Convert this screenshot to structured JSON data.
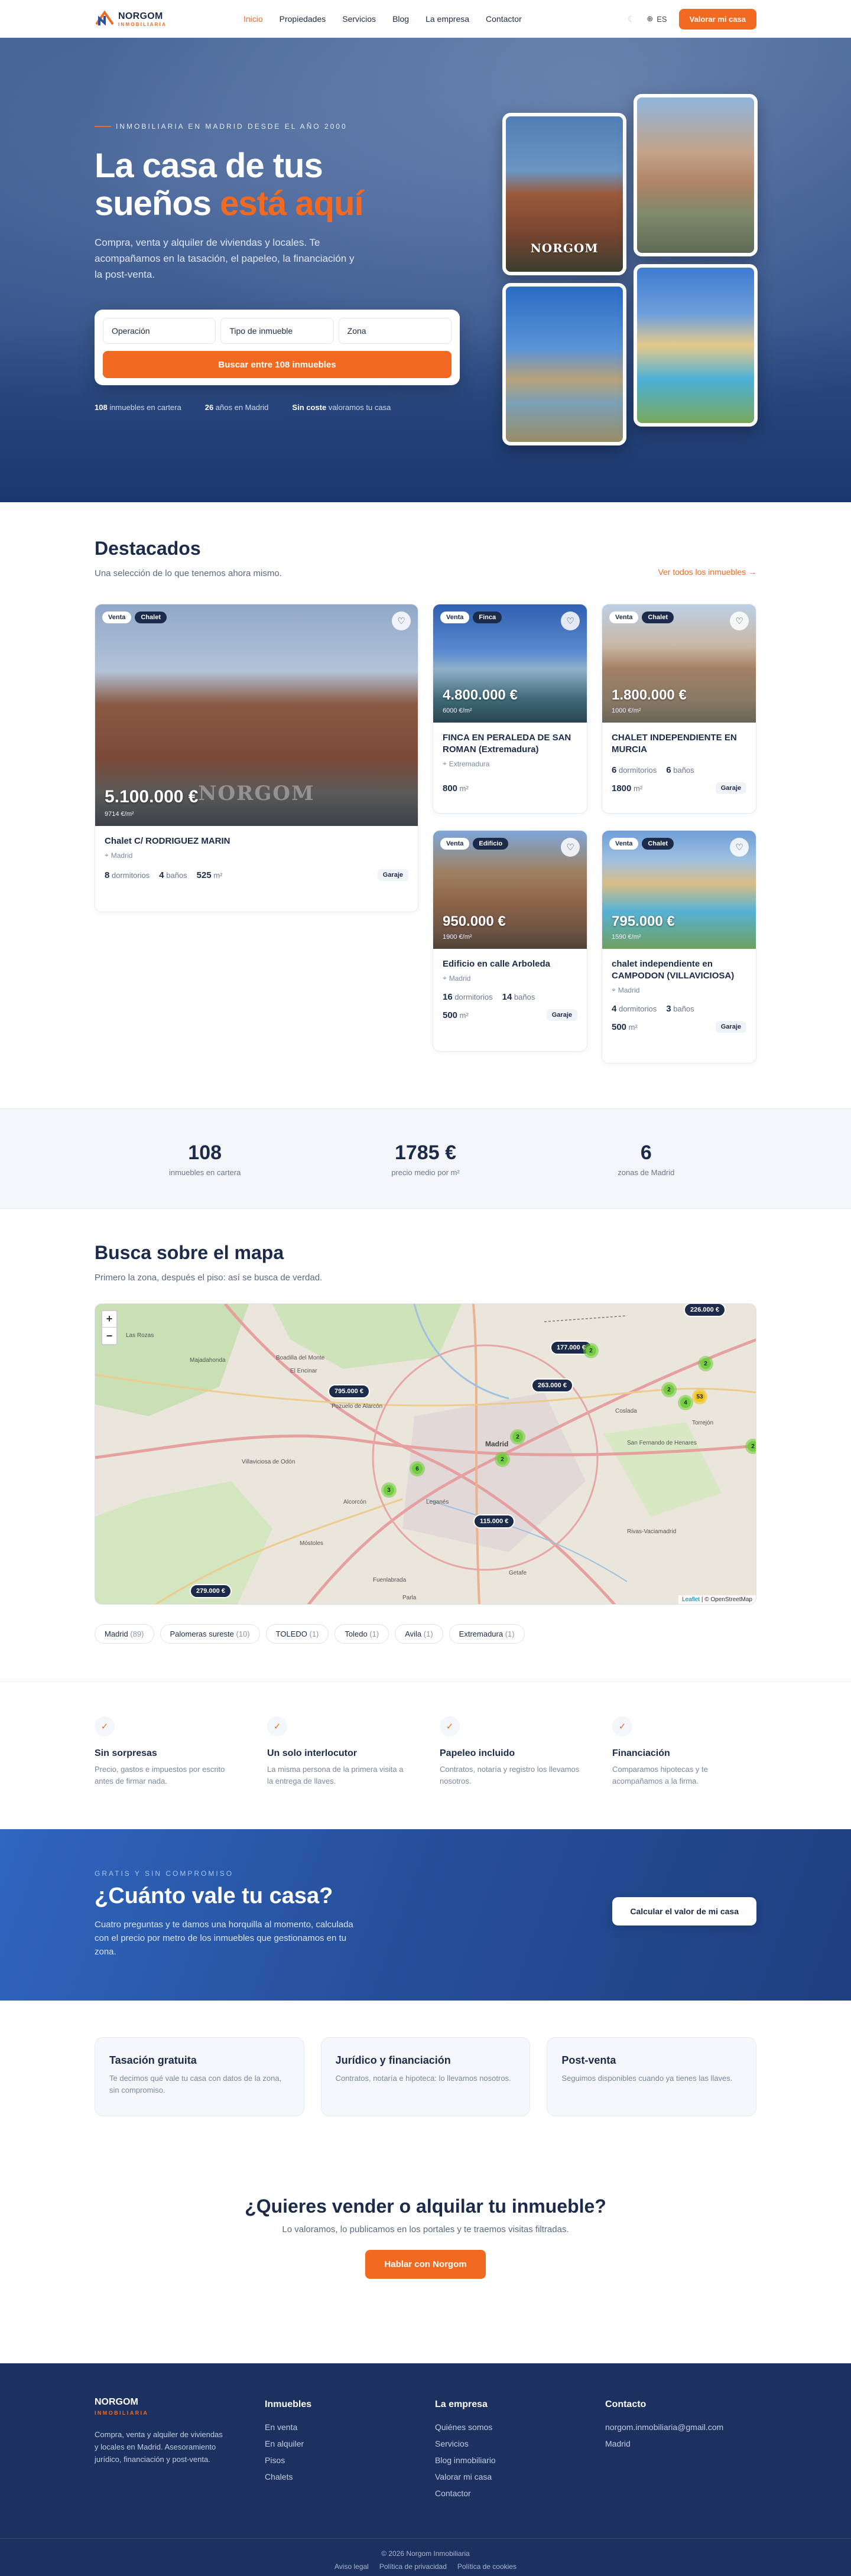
{
  "brand": {
    "name": "NORGOM",
    "sub": "INMOBILIARIA",
    "accent": "#f26a21",
    "navy": "#1c2b4a"
  },
  "nav": {
    "items": [
      "Inicio",
      "Propiedades",
      "Servicios",
      "Blog",
      "La empresa",
      "Contactor"
    ],
    "active": "Inicio",
    "lang": "ES",
    "cta": "Valorar mi casa"
  },
  "hero": {
    "eyebrow": "INMOBILIARIA EN MADRID DESDE EL AÑO 2000",
    "title_a": "La casa de tus",
    "title_b": "sueños ",
    "title_c": "está aquí",
    "lead": "Compra, venta y alquiler de viviendas y locales. Te acompañamos en la tasación, el papeleo, la financiación y la post-venta.",
    "search": {
      "operation": "Operación",
      "type": "Tipo de inmueble",
      "zone": "Zona",
      "button": "Buscar entre 108 inmuebles"
    },
    "stats": [
      {
        "b": "108",
        "t": " inmuebles en cartera"
      },
      {
        "b": "26",
        "t": " años en Madrid"
      },
      {
        "b": "Sin coste",
        "t": " valoramos tu casa"
      }
    ],
    "photo_logo": "NORGOM"
  },
  "featured": {
    "title": "Destacados",
    "subtitle": "Una selección de lo que tenemos ahora mismo.",
    "see_all": "Ver todos los inmuebles →",
    "cards": [
      {
        "op": "Venta",
        "kind": "Chalet",
        "price": "5.100.000 €",
        "ppm": "9714 €/m²",
        "title": "Chalet C/ RODRIGUEZ MARIN",
        "loc": "Madrid",
        "m1n": "8",
        "m1": "dormitorios",
        "m2n": "4",
        "m2": "baños",
        "m3n": "525",
        "m3": "m²",
        "tag": "Garaje",
        "watermark": "NORGOM"
      },
      {
        "op": "Venta",
        "kind": "Finca",
        "price": "4.800.000 €",
        "ppm": "6000 €/m²",
        "title": "FINCA EN PERALEDA DE SAN ROMAN (Extremadura)",
        "loc": "Extremadura",
        "m3n": "800",
        "m3": "m²"
      },
      {
        "op": "Venta",
        "kind": "Chalet",
        "price": "1.800.000 €",
        "ppm": "1000 €/m²",
        "title": "CHALET INDEPENDIENTE EN MURCIA",
        "loc": "",
        "m1n": "6",
        "m1": "dormitorios",
        "m2n": "6",
        "m2": "baños",
        "m3n": "1800",
        "m3": "m²",
        "tag": "Garaje"
      },
      {
        "op": "Venta",
        "kind": "Edificio",
        "price": "950.000 €",
        "ppm": "1900 €/m²",
        "title": "Edificio en calle Arboleda",
        "loc": "Madrid",
        "m1n": "16",
        "m1": "dormitorios",
        "m2n": "14",
        "m2": "baños",
        "m3n": "500",
        "m3": "m²",
        "tag": "Garaje"
      },
      {
        "op": "Venta",
        "kind": "Chalet",
        "price": "795.000 €",
        "ppm": "1590 €/m²",
        "title": "chalet independiente en CAMPODON (VILLAVICIOSA)",
        "loc": "Madrid",
        "m1n": "4",
        "m1": "dormitorios",
        "m2n": "3",
        "m2": "baños",
        "m3n": "500",
        "m3": "m²",
        "tag": "Garaje"
      }
    ]
  },
  "stats_band": [
    {
      "n": "108",
      "l": "inmuebles en cartera"
    },
    {
      "n": "1785 €",
      "l": "precio medio por m²"
    },
    {
      "n": "6",
      "l": "zonas de Madrid"
    }
  ],
  "map": {
    "title": "Busca sobre el mapa",
    "subtitle": "Primero la zona, después el piso: así se busca de verdad.",
    "zoom_in": "+",
    "zoom_out": "−",
    "pins": [
      "226.000 €",
      "177.000 €",
      "795.000 €",
      "263.000 €",
      "115.000 €",
      "279.000 €"
    ],
    "clusters": [
      "2",
      "2",
      "2",
      "4",
      "53",
      "2",
      "6",
      "2",
      "3",
      "2"
    ],
    "place_labels": [
      "Las Rozas",
      "Boadilla del Monte",
      "El Encinar",
      "Villaviciosa de Odón",
      "Madrid",
      "Móstoles",
      "Leganés",
      "Fuenlabrada",
      "Parla",
      "Getafe",
      "Rivas-Vaciamadrid",
      "Coslada",
      "San Fernando de Henares",
      "Torrejón",
      "Alcorcón",
      "Pozuelo de Alarcón",
      "Majadahonda"
    ],
    "attribution_link": "Leaflet",
    "attribution_rest": " | © OpenStreetMap",
    "chips": [
      {
        "name": "Madrid",
        "count": "(89)"
      },
      {
        "name": "Palomeras sureste",
        "count": "(10)"
      },
      {
        "name": "TOLEDO",
        "count": "(1)"
      },
      {
        "name": "Toledo",
        "count": "(1)"
      },
      {
        "name": "Avila",
        "count": "(1)"
      },
      {
        "name": "Extremadura",
        "count": "(1)"
      }
    ]
  },
  "features": [
    {
      "title": "Sin sorpresas",
      "text": "Precio, gastos e impuestos por escrito antes de firmar nada."
    },
    {
      "title": "Un solo interlocutor",
      "text": "La misma persona de la primera visita a la entrega de llaves."
    },
    {
      "title": "Papeleo incluido",
      "text": "Contratos, notaría y registro los llevamos nosotros."
    },
    {
      "title": "Financiación",
      "text": "Comparamos hipotecas y te acompañamos a la firma."
    }
  ],
  "valuation": {
    "eyebrow": "GRATIS Y SIN COMPROMISO",
    "title": "¿Cuánto vale tu casa?",
    "text": "Cuatro preguntas y te damos una horquilla al momento, calculada con el precio por metro de los inmuebles que gestionamos en tu zona.",
    "button": "Calcular el valor de mi casa"
  },
  "services": [
    {
      "title": "Tasación gratuita",
      "text": "Te decimos qué vale tu casa con datos de la zona, sin compromiso."
    },
    {
      "title": "Jurídico y financiación",
      "text": "Contratos, notaría e hipoteca: lo llevamos nosotros."
    },
    {
      "title": "Post-venta",
      "text": "Seguimos disponibles cuando ya tienes las llaves."
    }
  ],
  "sell": {
    "title": "¿Quieres vender o alquilar tu inmueble?",
    "text": "Lo valoramos, lo publicamos en los portales y te traemos visitas filtradas.",
    "button": "Hablar con Norgom"
  },
  "footer": {
    "desc": "Compra, venta y alquiler de viviendas y locales en Madrid. Asesoramiento jurídico, financiación y post-venta.",
    "col2": {
      "title": "Inmuebles",
      "links": [
        "En venta",
        "En alquiler",
        "Pisos",
        "Chalets"
      ]
    },
    "col3": {
      "title": "La empresa",
      "links": [
        "Quiénes somos",
        "Servicios",
        "Blog inmobiliario",
        "Valorar mi casa",
        "Contactor"
      ]
    },
    "col4": {
      "title": "Contacto",
      "links": [
        "norgom.inmobiliaria@gmail.com",
        "Madrid"
      ]
    },
    "copyright": "© 2026 Norgom Inmobiliaria",
    "legal": [
      "Aviso legal",
      "Política de privacidad",
      "Política de cookies"
    ]
  }
}
